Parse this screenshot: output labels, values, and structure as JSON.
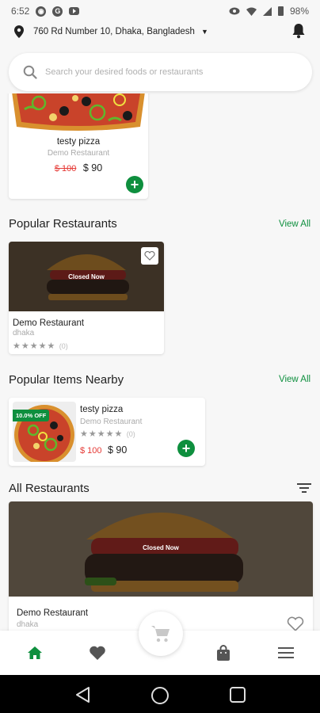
{
  "status_bar": {
    "time": "6:52",
    "battery": "98%"
  },
  "location": {
    "address": "760 Rd Number 10, Dhaka, Bangladesh"
  },
  "search": {
    "placeholder": "Search your desired foods or restaurants"
  },
  "top_food_card": {
    "name": "testy pizza",
    "restaurant": "Demo Restaurant",
    "old_price": "$ 100",
    "price": "$ 90"
  },
  "popular_restaurants": {
    "title": "Popular Restaurants",
    "view_all": "View All",
    "items": [
      {
        "name": "Demo Restaurant",
        "location": "dhaka",
        "overlay": "Closed Now",
        "rating_count": "(0)"
      }
    ]
  },
  "popular_items": {
    "title": "Popular Items Nearby",
    "view_all": "View All",
    "items": [
      {
        "discount": "10.0% OFF",
        "name": "testy pizza",
        "restaurant": "Demo Restaurant",
        "rating_count": "(0)",
        "old_price": "$ 100",
        "price": "$ 90"
      }
    ]
  },
  "all_restaurants": {
    "title": "All Restaurants",
    "items": [
      {
        "name": "Demo Restaurant",
        "location": "dhaka",
        "overlay": "Closed Now"
      }
    ]
  },
  "colors": {
    "accent": "#0e8f3e",
    "old_price": "#e53935"
  },
  "bottom_nav": {
    "items": [
      "home-icon",
      "heart-icon",
      "cart-icon",
      "bag-icon",
      "menu-icon"
    ],
    "active": "home-icon"
  }
}
